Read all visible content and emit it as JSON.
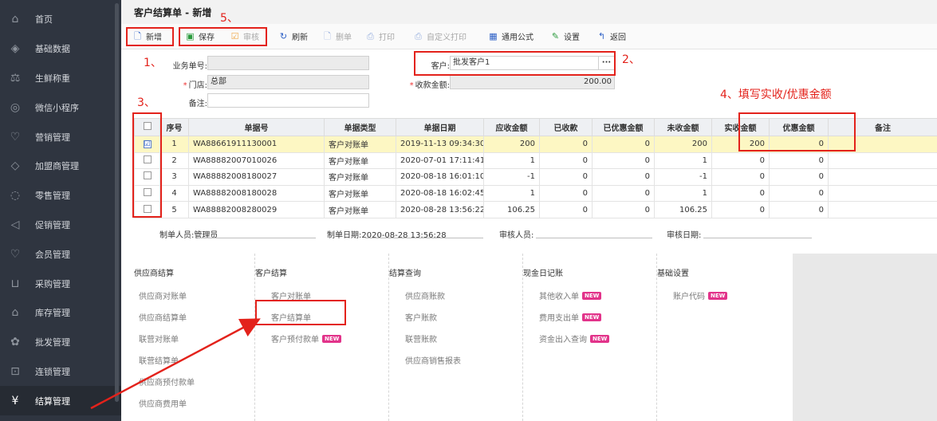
{
  "sidebar": {
    "items": [
      {
        "label": "首页",
        "icon": "home-icon",
        "glyph": "⌂"
      },
      {
        "label": "基础数据",
        "icon": "layers-icon",
        "glyph": "◈"
      },
      {
        "label": "生鲜称重",
        "icon": "scale-icon",
        "glyph": "⚖"
      },
      {
        "label": "微信小程序",
        "icon": "mini-program-icon",
        "glyph": "◎"
      },
      {
        "label": "营销管理",
        "icon": "marketing-icon",
        "glyph": "♡"
      },
      {
        "label": "加盟商管理",
        "icon": "franchise-icon",
        "glyph": "◇"
      },
      {
        "label": "零售管理",
        "icon": "retail-icon",
        "glyph": "◌"
      },
      {
        "label": "促销管理",
        "icon": "promotion-icon",
        "glyph": "◁"
      },
      {
        "label": "会员管理",
        "icon": "member-icon",
        "glyph": "♡"
      },
      {
        "label": "采购管理",
        "icon": "cart-icon",
        "glyph": "⊔"
      },
      {
        "label": "库存管理",
        "icon": "warehouse-icon",
        "glyph": "⌂"
      },
      {
        "label": "批发管理",
        "icon": "wholesale-icon",
        "glyph": "✿"
      },
      {
        "label": "连锁管理",
        "icon": "chain-icon",
        "glyph": "⊡"
      },
      {
        "label": "结算管理",
        "icon": "settlement-icon",
        "glyph": "¥"
      }
    ]
  },
  "page": {
    "title": "客户结算单 - 新增"
  },
  "toolbar": {
    "new": "新增",
    "save": "保存",
    "audit": "审核",
    "refresh": "刷新",
    "delete": "删单",
    "print": "打印",
    "custom_print": "自定义打印",
    "formula": "通用公式",
    "settings": "设置",
    "back": "返回"
  },
  "form": {
    "doc_no_label": "业务单号:",
    "doc_no_value": "",
    "store_label": "门店:",
    "store_value": "总部",
    "note_label": "备注:",
    "note_value": "",
    "customer_label": "客户:",
    "customer_value": "批发客户1",
    "customer_btn": "···",
    "amount_label": "收款金额:",
    "amount_value": "200.00"
  },
  "grid": {
    "headers": [
      "序号",
      "单据号",
      "单据类型",
      "单据日期",
      "应收金额",
      "已收款",
      "已优惠金额",
      "未收金额",
      "实收金额",
      "优惠金额",
      "备注"
    ],
    "rows": [
      {
        "checked": "☑",
        "seq": "1",
        "doc": "WA88661911130001",
        "type": "客户对账单",
        "date": "2019-11-13 09:34:30",
        "due": "200",
        "received": "0",
        "discounted": "0",
        "unpaid": "200",
        "actual": "200",
        "discount": "0",
        "note": ""
      },
      {
        "checked": "",
        "seq": "2",
        "doc": "WA88882007010026",
        "type": "客户对账单",
        "date": "2020-07-01 17:11:41",
        "due": "1",
        "received": "0",
        "discounted": "0",
        "unpaid": "1",
        "actual": "0",
        "discount": "0",
        "note": ""
      },
      {
        "checked": "",
        "seq": "3",
        "doc": "WA88882008180027",
        "type": "客户对账单",
        "date": "2020-08-18 16:01:10",
        "due": "-1",
        "received": "0",
        "discounted": "0",
        "unpaid": "-1",
        "actual": "0",
        "discount": "0",
        "note": ""
      },
      {
        "checked": "",
        "seq": "4",
        "doc": "WA88882008180028",
        "type": "客户对账单",
        "date": "2020-08-18 16:02:45",
        "due": "1",
        "received": "0",
        "discounted": "0",
        "unpaid": "1",
        "actual": "0",
        "discount": "0",
        "note": ""
      },
      {
        "checked": "",
        "seq": "5",
        "doc": "WA88882008280029",
        "type": "客户对账单",
        "date": "2020-08-28 13:56:22",
        "due": "106.25",
        "received": "0",
        "discounted": "0",
        "unpaid": "106.25",
        "actual": "0",
        "discount": "0",
        "note": ""
      }
    ]
  },
  "footer": {
    "maker_label": "制单人员:",
    "maker_value": "管理员",
    "make_date_label": "制单日期:",
    "make_date_value": "2020-08-28 13:56:28",
    "auditor_label": "审核人员:",
    "auditor_value": "",
    "audit_date_label": "审核日期:",
    "audit_date_value": ""
  },
  "mega_menu": {
    "columns": [
      {
        "title": "供应商结算",
        "items": [
          {
            "label": "供应商对账单",
            "new": ""
          },
          {
            "label": "供应商结算单",
            "new": ""
          },
          {
            "label": "联营对账单",
            "new": ""
          },
          {
            "label": "联营结算单",
            "new": ""
          },
          {
            "label": "供应商预付款单",
            "new": ""
          },
          {
            "label": "供应商费用单",
            "new": ""
          }
        ]
      },
      {
        "title": "客户结算",
        "items": [
          {
            "label": "客户对账单",
            "new": ""
          },
          {
            "label": "客户结算单",
            "new": ""
          },
          {
            "label": "客户预付款单",
            "new": "NEW"
          }
        ]
      },
      {
        "title": "结算查询",
        "items": [
          {
            "label": "供应商账款",
            "new": ""
          },
          {
            "label": "客户账款",
            "new": ""
          },
          {
            "label": "联营账款",
            "new": ""
          },
          {
            "label": "供应商销售报表",
            "new": ""
          }
        ]
      },
      {
        "title": "现金日记账",
        "items": [
          {
            "label": "其他收入单",
            "new": "NEW"
          },
          {
            "label": "费用支出单",
            "new": "NEW"
          },
          {
            "label": "资金出入查询",
            "new": "NEW"
          }
        ]
      },
      {
        "title": "基础设置",
        "items": [
          {
            "label": "账户代码",
            "new": "NEW"
          }
        ]
      }
    ]
  },
  "annotations": {
    "n1": "1、",
    "n2": "2、",
    "n3": "3、",
    "n4": "4、填写实收/优惠金额",
    "n5": "5、",
    "color": "#e3221b"
  },
  "colors": {
    "sidebar_bg": "#2f3540",
    "accent_blue": "#2d60c6",
    "selected_row": "#fdf7c3",
    "badge": "#e2338a"
  }
}
